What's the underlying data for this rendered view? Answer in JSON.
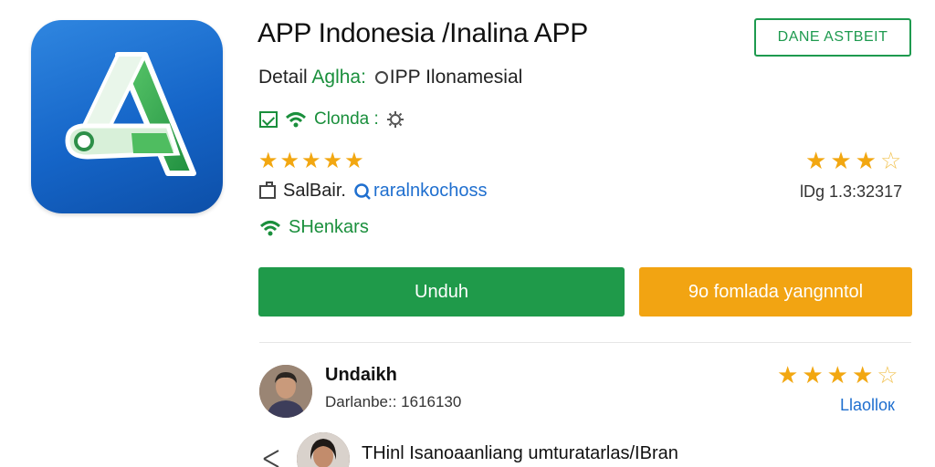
{
  "app": {
    "title": "APP Indonesia /Inalina APP",
    "subtitle_prefix": "Detail",
    "subtitle_highlight": "Aglha:",
    "subtitle_rest": "IPP Ilonamesial",
    "developer": "Clonda :",
    "selection_label": "SalBair.",
    "selection_link": "raralnkochoss",
    "category": "SHenkars",
    "meta_right": "lDg 1.3:32317",
    "top_button": "DANE ASTBEIT"
  },
  "ratings": {
    "main_stars": 5,
    "right_stars_filled": 3,
    "right_stars_total": 4
  },
  "buttons": {
    "primary": "Unduh",
    "secondary": "9o fomlada yangnntol"
  },
  "review": {
    "name": "Undaikh",
    "date": "Darlanbe:: 1616130",
    "link": "Llaolloк",
    "stars_filled": 4,
    "stars_total": 5,
    "text": "THinl Isanoaanliang umturatarlas/IBran"
  },
  "colors": {
    "green": "#1f9a4a",
    "orange": "#f2a412",
    "blue_link": "#1f6fcf",
    "star": "#f2a711"
  },
  "icons": {
    "app": "app-logo-A",
    "check": "check-box-icon",
    "wifi": "wifi-icon",
    "gear": "gear-icon",
    "search": "search-icon",
    "box": "package-icon",
    "share": "share-icon"
  }
}
